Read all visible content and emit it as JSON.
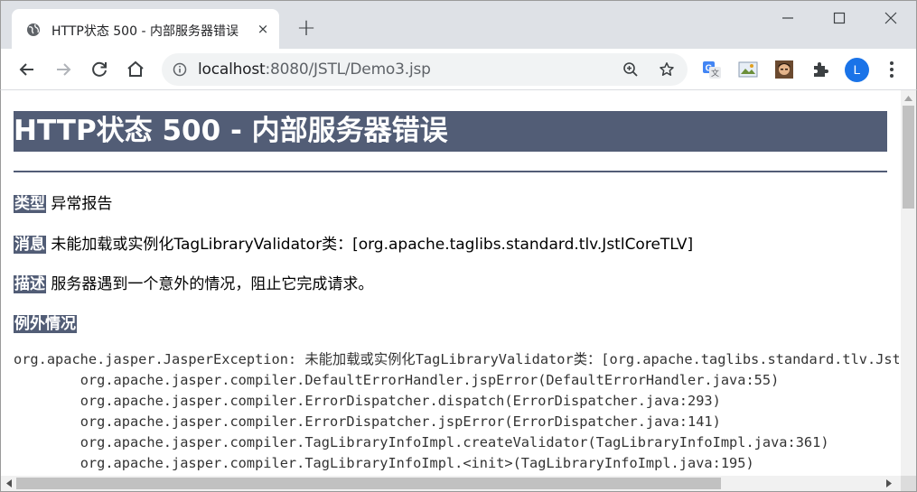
{
  "browser": {
    "tab": {
      "title": "HTTP状态 500 - 内部服务器错误",
      "close": "×",
      "new_tab": "+"
    },
    "address": {
      "host": "localhost",
      "path": ":8080/JSTL/Demo3.jsp"
    },
    "profile_initial": "L"
  },
  "page": {
    "title": "HTTP状态 500 - 内部服务器错误",
    "type_label": "类型",
    "type_value": "异常报告",
    "message_label": "消息",
    "message_value": "未能加载或实例化TagLibraryValidator类：[org.apache.taglibs.standard.tlv.JstlCoreTLV]",
    "description_label": "描述",
    "description_value": "服务器遇到一个意外的情况，阻止它完成请求。",
    "exception_label": "例外情况",
    "stack_trace": "org.apache.jasper.JasperException: 未能加载或实例化TagLibraryValidator类：[org.apache.taglibs.standard.tlv.JstlCoreTLV]\n\torg.apache.jasper.compiler.DefaultErrorHandler.jspError(DefaultErrorHandler.java:55)\n\torg.apache.jasper.compiler.ErrorDispatcher.dispatch(ErrorDispatcher.java:293)\n\torg.apache.jasper.compiler.ErrorDispatcher.jspError(ErrorDispatcher.java:141)\n\torg.apache.jasper.compiler.TagLibraryInfoImpl.createValidator(TagLibraryInfoImpl.java:361)\n\torg.apache.jasper.compiler.TagLibraryInfoImpl.<init>(TagLibraryInfoImpl.java:195)"
  },
  "icons": [
    "globe-icon",
    "close-icon",
    "plus-icon",
    "minimize-icon",
    "maximize-icon",
    "window-close-icon",
    "back-icon",
    "forward-icon",
    "reload-icon",
    "home-icon",
    "info-icon",
    "zoom-icon",
    "star-icon",
    "translate-icon",
    "image-extension-icon",
    "avatar-extension-icon",
    "puzzle-icon",
    "kebab-menu-icon"
  ],
  "colors": {
    "header_bg": "#525d76",
    "chrome_bg": "#dee1e6",
    "omnibox_bg": "#f1f3f4",
    "profile": "#1a73e8"
  }
}
